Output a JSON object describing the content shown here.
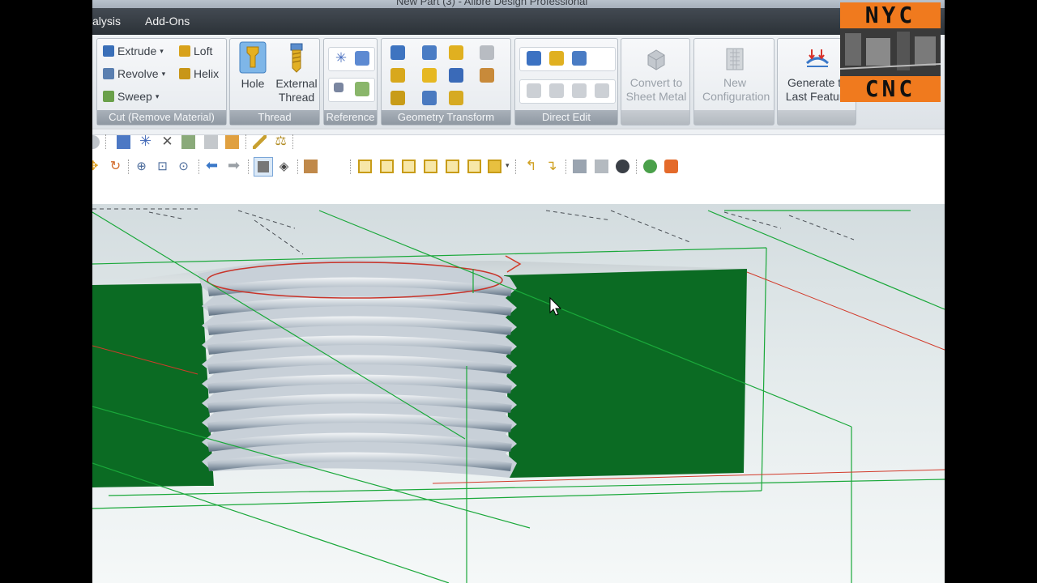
{
  "window": {
    "title": "New Part (3) - Alibre Design Professional"
  },
  "menu": {
    "items": [
      {
        "label": "alysis"
      },
      {
        "label": "Add-Ons"
      }
    ]
  },
  "ribbon": {
    "cut": {
      "extrude": "Extrude",
      "revolve": "Revolve",
      "sweep": "Sweep",
      "loft": "Loft",
      "helix": "Helix",
      "label": "Cut (Remove Material)"
    },
    "thread": {
      "hole": "Hole",
      "external_thread": "External Thread",
      "label": "Thread"
    },
    "reference": {
      "label": "Reference"
    },
    "geometry_transform": {
      "label": "Geometry Transform"
    },
    "direct_edit": {
      "label": "Direct Edit"
    },
    "convert": {
      "label": "Convert to Sheet Metal"
    },
    "configuration": {
      "label": "New Configuration"
    },
    "generate": {
      "label": "Generate to Last Feature"
    }
  },
  "overlay": {
    "top": "NYC",
    "bottom": "CNC"
  },
  "colors": {
    "part_green": "#0b6b23",
    "sketch_green": "#1aa83a",
    "sketch_red": "#d23a2a",
    "menu_bg": "#353b42"
  }
}
